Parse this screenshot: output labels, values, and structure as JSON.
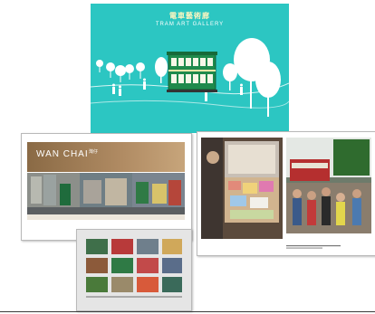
{
  "cover": {
    "title_cn": "電車藝術廊",
    "title_en": "TRAM ART GALLERY",
    "background": "#2cc6c2",
    "tram_color": "#1f8a4c"
  },
  "spread_wanchai": {
    "banner_title": "WAN CHAI",
    "banner_sub": "灣仔"
  }
}
